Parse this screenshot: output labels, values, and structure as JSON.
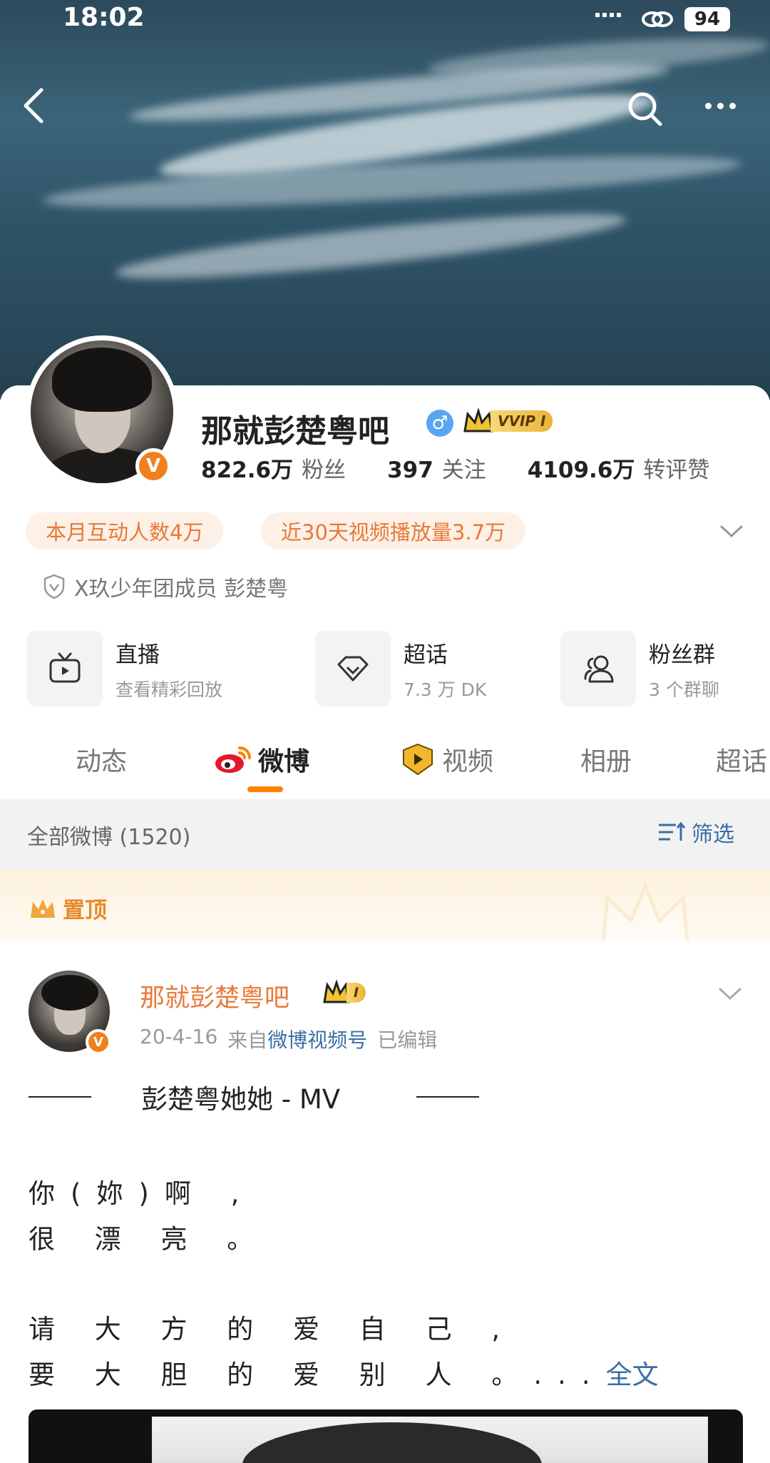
{
  "status_bar": {
    "time": "18:02",
    "battery": "94"
  },
  "profile": {
    "name": "那就彭楚粤吧",
    "vip_badge": "VVIP I",
    "avatar_badge": "V",
    "stats": [
      {
        "value": "822.6万",
        "label": "粉丝"
      },
      {
        "value": "397",
        "label": "关注"
      },
      {
        "value": "4109.6万",
        "label": "转评赞"
      }
    ],
    "pills": [
      "本月互动人数4万",
      "近30天视频播放量3.7万"
    ],
    "verification": "X玖少年团成员 彭楚粤"
  },
  "features": [
    {
      "title": "直播",
      "sub": "查看精彩回放",
      "icon": "tv-icon"
    },
    {
      "title": "超话",
      "sub": "7.3 万 DK",
      "icon": "diamond-icon"
    },
    {
      "title": "粉丝群",
      "sub": "3 个群聊",
      "icon": "group-icon"
    }
  ],
  "tabs": [
    "动态",
    "微博",
    "视频",
    "相册",
    "超话"
  ],
  "active_tab": "微博",
  "filter": {
    "label": "全部微博 (1520)",
    "button": "筛选"
  },
  "pinned": {
    "label": "置顶"
  },
  "post": {
    "author": "那就彭楚粤吧",
    "badge": "I",
    "date": "20-4-16",
    "from_prefix": "来自",
    "source": "微博视频号",
    "edited": "已编辑",
    "title": "彭楚粤她她 - MV",
    "lines": [
      "你(妳)啊 ,",
      "很 漂 亮 。",
      "请 大 方 的 爱 自 己 ,",
      "要 大 胆 的 爱 别 人 。..."
    ],
    "full_text": "全文"
  },
  "colors": {
    "accent": "#ff8200",
    "orange_text": "#e8793a",
    "link": "#3a6ea5",
    "pill_bg": "#fdf0e6"
  }
}
